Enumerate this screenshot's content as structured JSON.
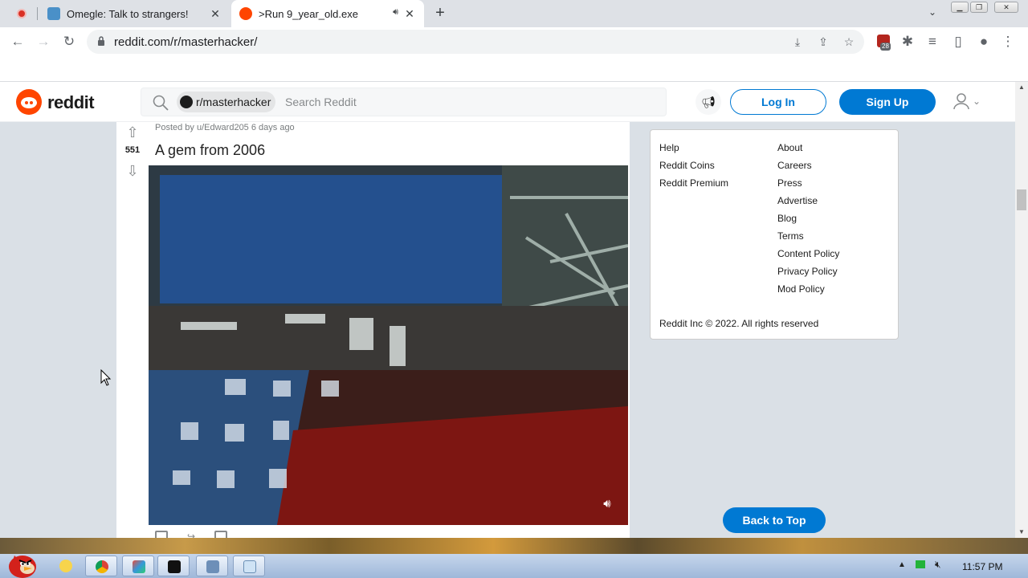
{
  "browser": {
    "tabs": [
      {
        "label": "Omegle: Talk to strangers!",
        "favicon": "omegle-icon"
      },
      {
        "label": ">Run 9_year_old.exe",
        "favicon": "reddit-icon"
      }
    ],
    "url": "reddit.com/r/masterhacker/",
    "extension_badge_count": "28"
  },
  "reddit": {
    "wordmark": "reddit",
    "search": {
      "community_chip": "r/masterhacker",
      "placeholder": "Search Reddit"
    },
    "login_label": "Log In",
    "signup_label": "Sign Up"
  },
  "post": {
    "score": "551",
    "meta": "Posted by u/Edward205 6 days ago",
    "title": "A gem from 2006"
  },
  "sidebar": {
    "col1": [
      "Help",
      "Reddit Coins",
      "Reddit Premium"
    ],
    "col2": [
      "About",
      "Careers",
      "Press",
      "Advertise",
      "Blog",
      "Terms",
      "Content Policy",
      "Privacy Policy",
      "Mod Policy"
    ],
    "copyright": "Reddit Inc © 2022. All rights reserved"
  },
  "back_to_top_label": "Back to Top",
  "taskbar": {
    "clock": "11:57 PM"
  },
  "colors": {
    "reddit_orange": "#ff4500",
    "reddit_blue": "#0079d3"
  }
}
